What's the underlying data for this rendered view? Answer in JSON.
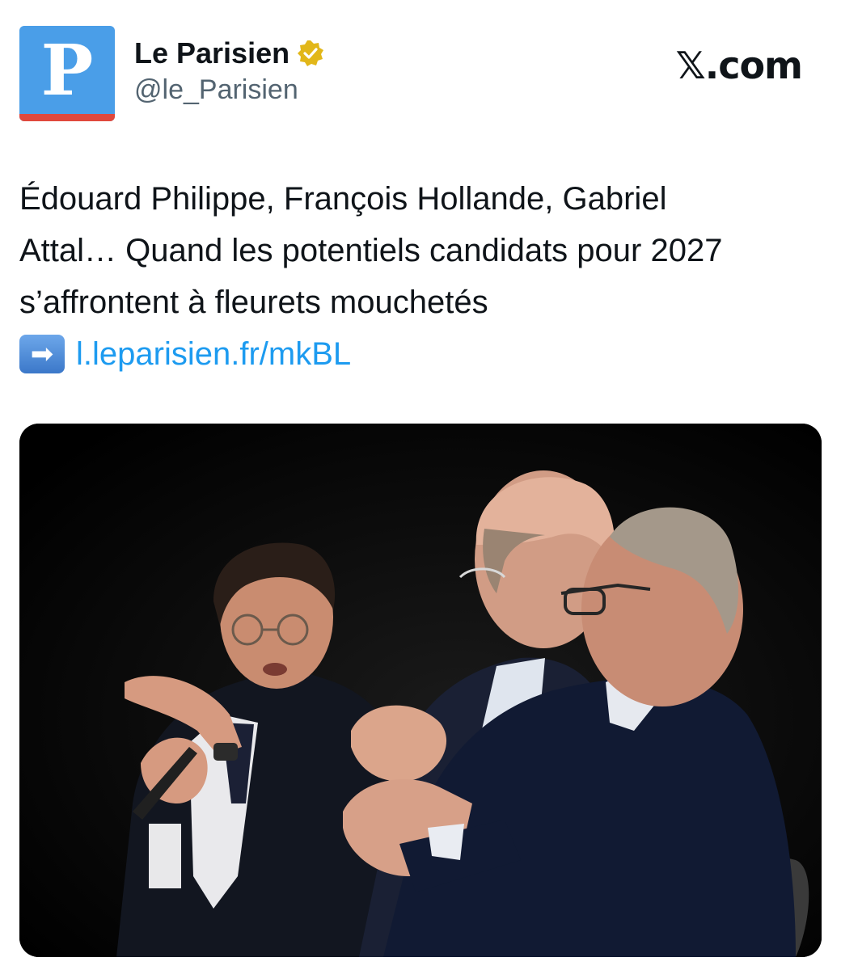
{
  "account": {
    "avatar_letter": "P",
    "display_name": "Le Parisien",
    "handle": "@le_Parisien",
    "verified_icon": "verified-badge-icon",
    "avatar_colors": {
      "background": "#4a9ee8",
      "stripe": "#e0483c"
    }
  },
  "brand": {
    "label": "𝕏.com"
  },
  "tweet": {
    "lines": [
      "Édouard Philippe, François Hollande, Gabriel",
      "Attal… Quand les potentiels candidats pour 2027",
      "s’affrontent à fleurets mouchetés"
    ],
    "arrow_emoji": "➡",
    "link_text": "l.leparisien.fr/mkBL",
    "link_color": "#1d9bf0"
  },
  "media": {
    "description_icon": "photo-image",
    "background": "#000000"
  }
}
